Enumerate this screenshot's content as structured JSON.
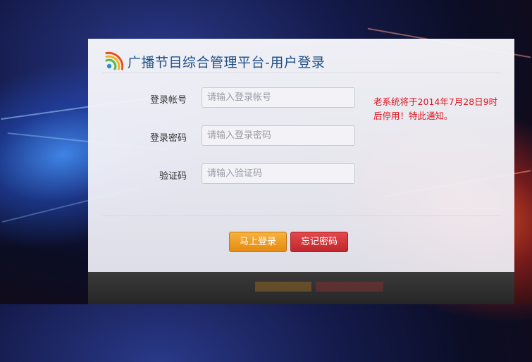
{
  "header": {
    "title": "广播节目综合管理平台-用户登录"
  },
  "form": {
    "account": {
      "label": "登录帐号",
      "placeholder": "请输入登录帐号"
    },
    "password": {
      "label": "登录密码",
      "placeholder": "请输入登录密码"
    },
    "captcha": {
      "label": "验证码",
      "placeholder": "请输入验证码"
    }
  },
  "notice": "老系统将于2014年7月28日9时后停用！特此通知。",
  "buttons": {
    "login": "马上登录",
    "forgot": "忘记密码"
  },
  "colors": {
    "title": "#1f4f86",
    "notice": "#e0141e",
    "login_button": "#f0a028",
    "forgot_button": "#d0363b"
  },
  "icons": {
    "logo": "broadcast-signal-logo"
  }
}
